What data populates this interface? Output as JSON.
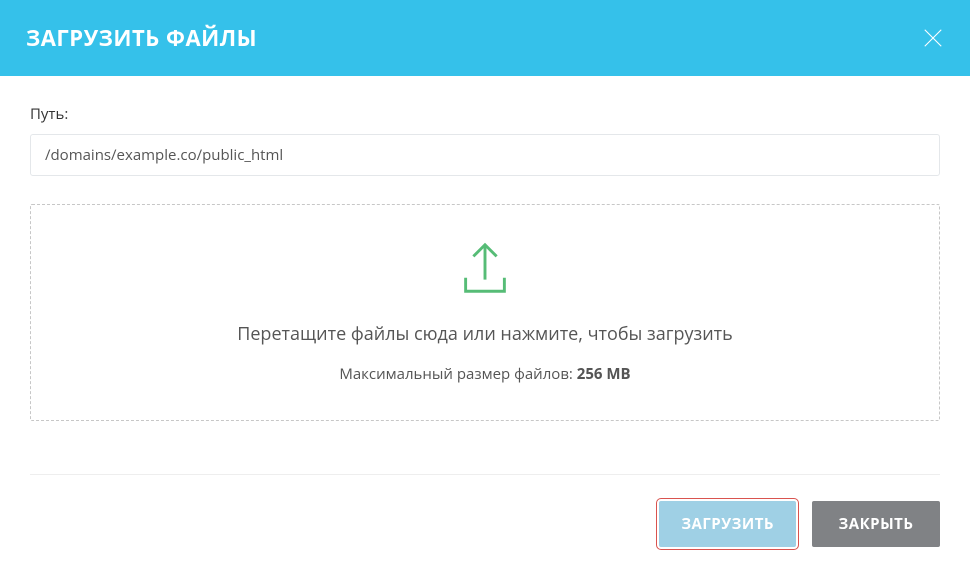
{
  "header": {
    "title": "ЗАГРУЗИТЬ ФАЙЛЫ"
  },
  "path": {
    "label": "Путь:",
    "value": "/domains/example.co/public_html"
  },
  "dropzone": {
    "text": "Перетащите файлы сюда или нажмите, чтобы загрузить",
    "max_size_label": "Максимальный размер файлов: ",
    "max_size_value": "256 MB"
  },
  "footer": {
    "upload_label": "ЗАГРУЗИТЬ",
    "close_label": "ЗАКРЫТЬ"
  }
}
